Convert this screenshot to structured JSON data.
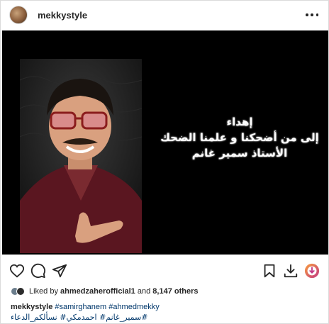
{
  "post": {
    "username": "mekkystyle",
    "avatar_icon": "user-avatar",
    "image_text": {
      "line1": "إهداء",
      "line2": "إلى من أضحكنا و علمنا الضحك",
      "line3": "الأستاذ سمير غانم"
    },
    "likes": {
      "prefix": "Liked by",
      "user": "ahmedzaherofficial1",
      "middle": "and",
      "count": "8,147 others"
    },
    "caption": {
      "username": "mekkystyle",
      "hashtags_line1": "#samirghanem #ahmedmekky",
      "hashtags_line2": "سمير_غانم# احمدمكي# نسألكم_الدعاء#"
    }
  },
  "icons": {
    "like": "heart-icon",
    "comment": "comment-icon",
    "share": "send-icon",
    "save": "bookmark-icon",
    "download": "download-icon",
    "extension": "extension-icon",
    "more": "more-icon"
  },
  "colors": {
    "link": "#00376b",
    "text": "#262626",
    "border": "#dbdbdb",
    "media_bg": "#000000",
    "extension_gradient_start": "#f9a03c",
    "extension_gradient_end": "#c13584"
  }
}
